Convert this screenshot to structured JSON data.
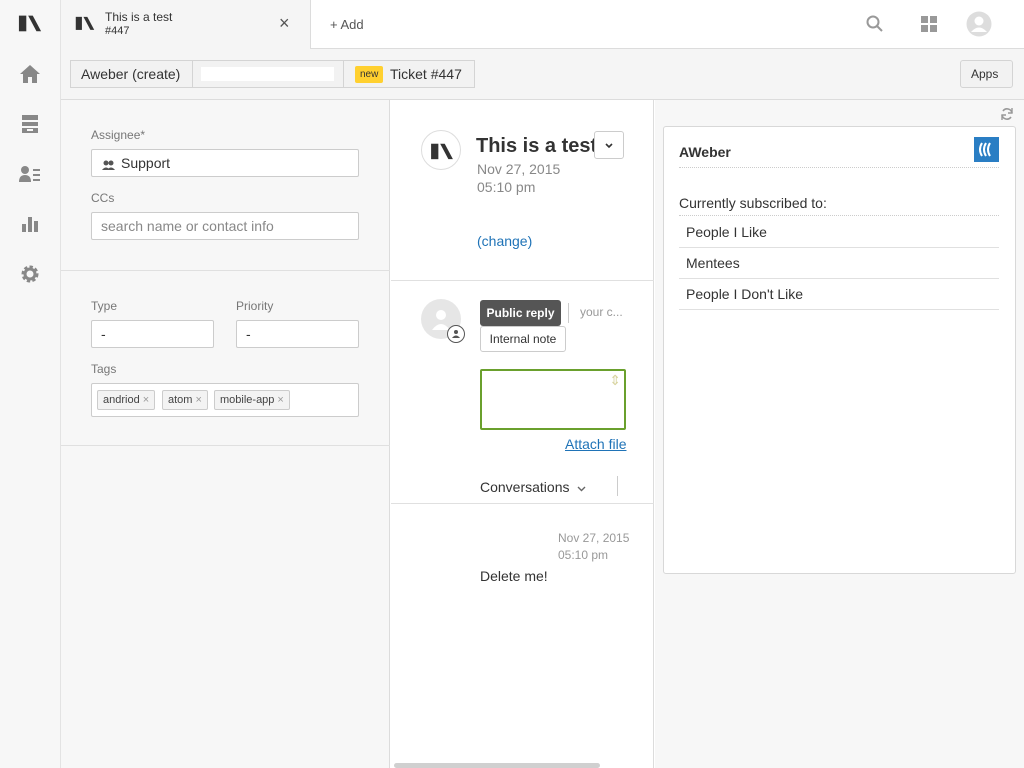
{
  "nav": {
    "items": [
      "logo",
      "home",
      "views",
      "customers",
      "reporting",
      "admin"
    ]
  },
  "topbar": {
    "tab_title": "This is a test",
    "tab_subtitle": "#447",
    "close_glyph": "×",
    "add_label": "+ Add"
  },
  "subbar": {
    "crumb_app": "Aweber (create)",
    "crumb_blank": "",
    "status_badge": "new",
    "ticket_label": "Ticket #447",
    "apps_label": "Apps"
  },
  "properties": {
    "assignee_label": "Assignee*",
    "assignee_value": "Support",
    "ccs_label": "CCs",
    "ccs_placeholder": "search name or contact info",
    "type_label": "Type",
    "type_value": "-",
    "priority_label": "Priority",
    "priority_value": "-",
    "tags_label": "Tags",
    "tags": [
      "andriod",
      "atom",
      "mobile-app"
    ]
  },
  "ticket": {
    "title": "This is a test",
    "date": "Nov 27, 2015",
    "time": "05:10 pm",
    "change_link": "(change)",
    "public_reply": "Public reply",
    "your_comment": "your c...",
    "internal_note": "Internal note",
    "attach_file": "Attach file",
    "conversations": "Conversations"
  },
  "conversation": {
    "date": "Nov 27, 2015",
    "time": "05:10 pm",
    "message": "Delete me!"
  },
  "aweber": {
    "title": "AWeber",
    "subscribed_label": "Currently subscribed to:",
    "lists": [
      "People I Like",
      "Mentees",
      "People I Don't Like"
    ]
  },
  "colors": {
    "accent_link": "#1f73b7",
    "badge_yellow": "#ffd02f",
    "reply_button": "#555555",
    "reply_box_border": "#6aa02d",
    "aweber_blue": "#2a7ec4"
  }
}
